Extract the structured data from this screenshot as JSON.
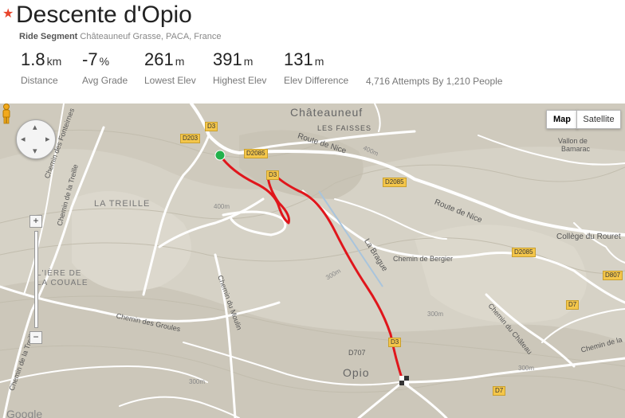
{
  "header": {
    "title": "Descente d'Opio",
    "segment_type": "Ride Segment",
    "location": "Châteauneuf Grasse, PACA, France",
    "stats": [
      {
        "value": "1.8",
        "unit": "km",
        "label": "Distance"
      },
      {
        "value": "-7",
        "unit": "%",
        "label": "Avg Grade"
      },
      {
        "value": "261",
        "unit": "m",
        "label": "Lowest Elev"
      },
      {
        "value": "391",
        "unit": "m",
        "label": "Highest Elev"
      },
      {
        "value": "131",
        "unit": "m",
        "label": "Elev Difference"
      }
    ],
    "attempts": "4,716 Attempts By 1,210 People"
  },
  "map": {
    "type_buttons": {
      "map": "Map",
      "satellite": "Satellite"
    },
    "zoom": {
      "in": "+",
      "out": "−"
    },
    "place_labels": {
      "chateauneuf": "Châteauneuf",
      "les_faisses": "LES FAISSES",
      "la_treille": "LA TREILLE",
      "iere_de": "L'IÈRE DE",
      "la_couale": "LA COUALE",
      "opio": "Opio",
      "vallon": "Vallon de",
      "bamarac": "Bamarac",
      "college": "Collège du Rouret",
      "google": "Google"
    },
    "road_labels": {
      "route_de_nice_1": "Route de Nice",
      "route_de_nice_2": "Route de Nice",
      "la_brague": "La Brague",
      "chemin_bergier": "Chemin de Bergier",
      "chemin_groules": "Chemin des Groules",
      "chemin_moulin": "Chemin du Moulin",
      "chemin_chateau": "Chemin du Château",
      "chemin_fonteirnes": "Chemin des Fonteirnes",
      "chemin_treille": "Chemin de la Treille",
      "chemin_treille_2": "Chemin de la Treille",
      "chemin_la": "Chemin de la",
      "contour_400": "400m",
      "contour_400b": "400m",
      "contour_300": "300m",
      "contour_300b": "300m",
      "contour_300c": "300m",
      "contour_300d": "300m"
    },
    "road_numbers": {
      "d3_top": "D3",
      "d203": "D203",
      "d2085_a": "D2085",
      "d3_mid": "D3",
      "d2085_b": "D2085",
      "d2085_c": "D2085",
      "d807": "D807",
      "d7_a": "D7",
      "d3_low": "D3",
      "d707": "D707",
      "d7_b": "D7"
    },
    "colors": {
      "route": "#e0161c",
      "start": "#22b14c",
      "roads": "#ffffff",
      "terrain": "#d6d2c6"
    }
  }
}
